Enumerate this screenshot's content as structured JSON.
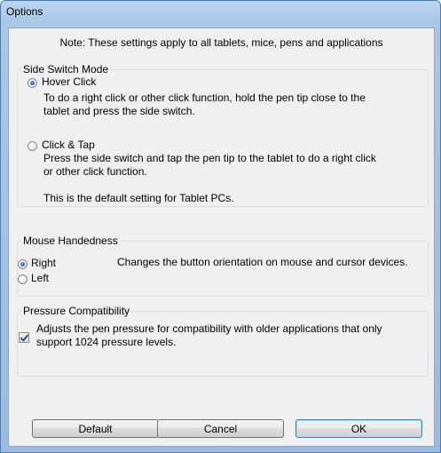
{
  "window": {
    "title": "Options"
  },
  "note": "Note: These settings apply to all tablets, mice, pens and applications",
  "side_switch": {
    "label": "Side Switch Mode",
    "hover_click": {
      "label": "Hover Click",
      "selected": true,
      "desc_line1": "To do a right click or other click function, hold the pen tip close to the",
      "desc_line2": "tablet and press the side switch."
    },
    "click_tap": {
      "label": "Click & Tap",
      "selected": false,
      "desc_line1": "Press the side switch and tap the pen tip to the tablet to do a right click",
      "desc_line2": "or other click function.",
      "desc_line3": "This is the default setting for Tablet PCs."
    }
  },
  "mouse_handedness": {
    "label": "Mouse Handedness",
    "right": {
      "label": "Right",
      "selected": true
    },
    "left": {
      "label": "Left",
      "selected": false
    },
    "desc": "Changes the button orientation on mouse and cursor devices."
  },
  "pressure": {
    "label": "Pressure Compatibility",
    "checked": true,
    "desc_line1": "Adjusts the pen pressure for compatibility with older applications that only",
    "desc_line2": "support 1024 pressure levels."
  },
  "buttons": {
    "default": "Default",
    "cancel": "Cancel",
    "ok": "OK"
  },
  "colors": {
    "frame": "#a9c6e7",
    "client": "#f0f0f0",
    "focus_border": "#3c7fb1"
  }
}
